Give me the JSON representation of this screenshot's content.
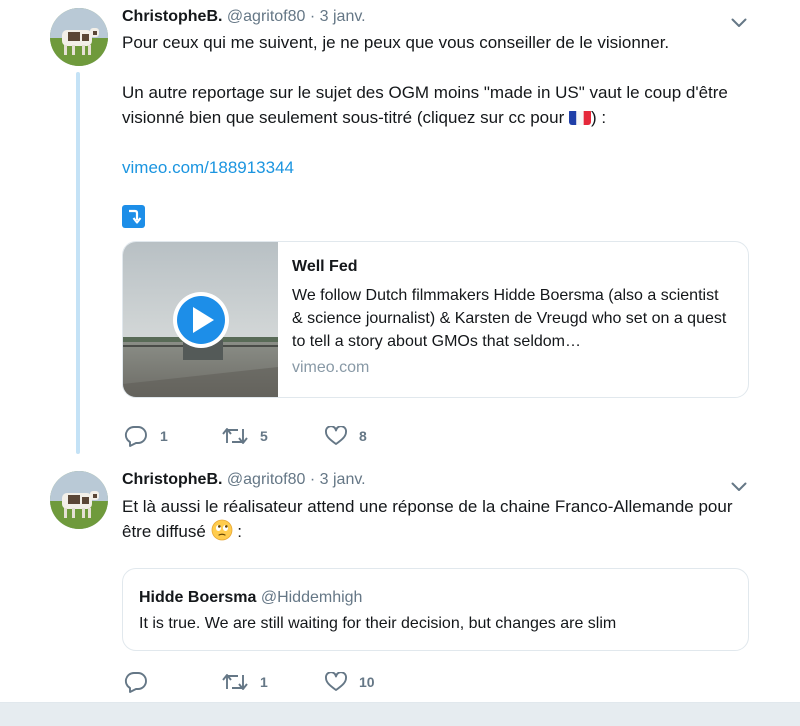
{
  "colors": {
    "link": "#1b95e0",
    "thread_line": "#c4e2f6",
    "muted": "#657786",
    "border": "#e1e8ed"
  },
  "tweets": [
    {
      "author": {
        "name": "ChristopheB.",
        "handle": "@agritof80"
      },
      "dot": "·",
      "date": "3 janv.",
      "paragraphs": [
        "Pour ceux qui me suivent, je ne peux que vous conseiller de le visionner.",
        "Un autre reportage sur le sujet des OGM moins \"made in US\" vaut le coup d'être visionné bien que seulement sous-titré (cliquez sur cc pour ",
        ") :"
      ],
      "flag_emoji": "france-flag",
      "link": "vimeo.com/188913344",
      "share_icon": "right-arrow-curving-down-icon",
      "card": {
        "title": "Well Fed",
        "description": "We follow Dutch filmmakers Hidde Boersma (also a scientist & science journalist) & Karsten de Vreugd who set on a quest to tell a story about GMOs that seldom…",
        "domain": "vimeo.com",
        "play_icon": "play-icon"
      },
      "actions": {
        "replies": "1",
        "retweets": "5",
        "likes": "8"
      }
    },
    {
      "author": {
        "name": "ChristopheB.",
        "handle": "@agritof80"
      },
      "dot": "·",
      "date": "3 janv.",
      "text_before_emoji": "Et là aussi le réalisateur attend une réponse de la chaine Franco-Allemande pour être diffusé ",
      "text_after_emoji": " :",
      "emoji": "face-with-rolling-eyes",
      "quote": {
        "name": "Hidde Boersma",
        "handle": "@Hiddemhigh",
        "text": "It is true. We are still waiting for their decision, but changes are slim"
      },
      "actions": {
        "replies": "",
        "retweets": "1",
        "likes": "10"
      }
    }
  ]
}
